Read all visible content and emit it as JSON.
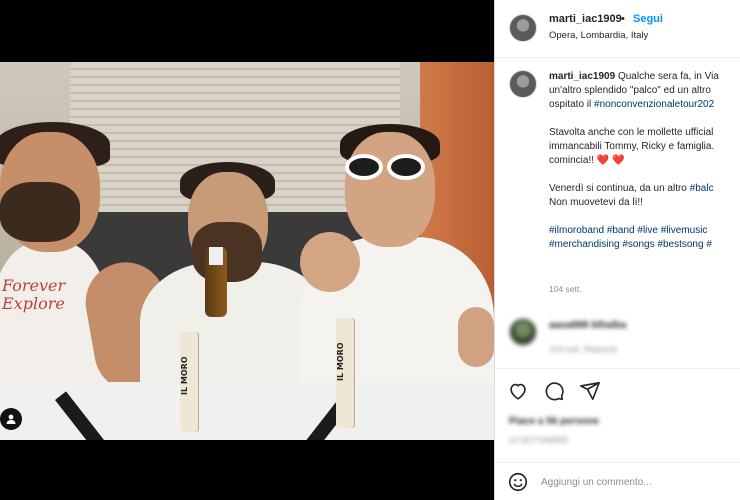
{
  "post": {
    "username": "marti_iac1909",
    "dot": "•",
    "follow_label": "Segui",
    "location": "Opera, Lombardia, Italy",
    "caption": {
      "line1_rest": " Qualche sera fa, in Via",
      "line2": "un'altro splendido \"palco\" ed un altro",
      "line3_prefix": "ospitato il ",
      "line3_tag": "#nonconvenzionaletour202",
      "line4": "Stavolta anche con le mollette ufficial",
      "line5": "immancabili Tommy, Ricky e famiglia.",
      "line6": "comincia!! ",
      "hearts": "❤️ ❤️",
      "line7_prefix": "Venerdì si continua, da un altro ",
      "line7_tag": "#balc",
      "line8": "Non muovetevi da lì!!",
      "tags_line1": "#ilmoroband #band #live #livemusic",
      "tags_line2": "#merchandising #songs #bestsong #"
    },
    "time_ago": "104 sett."
  },
  "comment": {
    "username": "aaoa888 blhalba",
    "meta": "104 sett.     Rispondi"
  },
  "actions": {
    "like": "heart-icon",
    "comment": "comment-icon",
    "share": "share-icon"
  },
  "likes_text": "Piace a 56 persone",
  "date_text": "14 SETTEMBRE",
  "comment_box": {
    "placeholder": "Aggiungi un commento..."
  },
  "photo": {
    "peg_text_left": "IL MORO",
    "peg_text_right": "IL MORO",
    "shirt_text": "Forever Explore"
  }
}
